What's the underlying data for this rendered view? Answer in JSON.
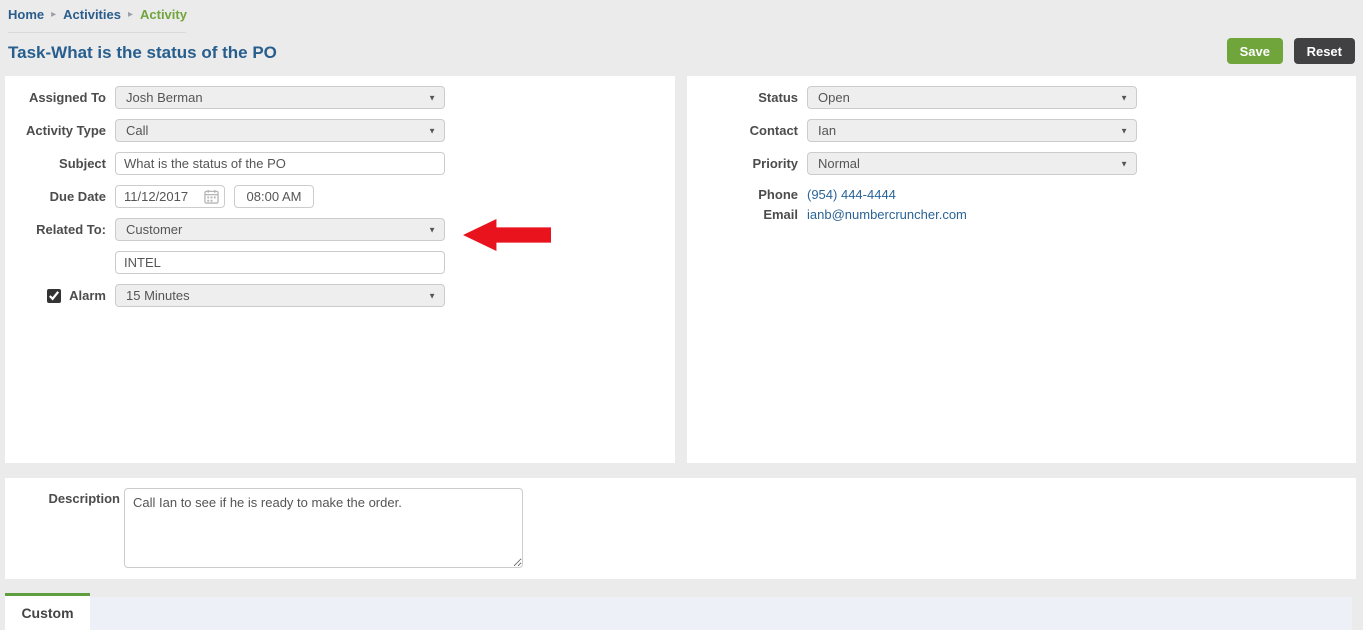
{
  "breadcrumb": {
    "separator": "▸",
    "home": "Home",
    "activities": "Activities",
    "current": "Activity"
  },
  "page": {
    "title": "Task-What is the status of the PO"
  },
  "toolbar": {
    "save_label": "Save",
    "reset_label": "Reset"
  },
  "left_panel": {
    "assigned_to": {
      "label": "Assigned To",
      "value": "Josh Berman"
    },
    "activity_type": {
      "label": "Activity Type",
      "value": "Call"
    },
    "subject": {
      "label": "Subject",
      "value": "What is the status of the PO"
    },
    "due_date": {
      "label": "Due Date",
      "date": "11/12/2017",
      "time": "08:00 AM"
    },
    "related_to": {
      "label": "Related To:",
      "value": "Customer"
    },
    "related_name": {
      "value": "INTEL"
    },
    "alarm": {
      "label": "Alarm",
      "checked": true,
      "value": "15 Minutes"
    }
  },
  "right_panel": {
    "status": {
      "label": "Status",
      "value": "Open"
    },
    "contact": {
      "label": "Contact",
      "value": "Ian"
    },
    "priority": {
      "label": "Priority",
      "value": "Normal"
    },
    "phone": {
      "label": "Phone",
      "value": "(954) 444-4444"
    },
    "email": {
      "label": "Email",
      "value": "ianb@numbercruncher.com"
    }
  },
  "description": {
    "label": "Description",
    "value": "Call Ian to see if he is ready to make the order."
  },
  "tabs": {
    "custom_label": "Custom"
  },
  "icons": {
    "dropdown_caret": "▼",
    "calendar": "calendar-icon"
  },
  "colors": {
    "page_background": "#ebebeb",
    "panel_background": "#ffffff",
    "title_blue": "#275e8e",
    "breadcrumb_blue": "#2a5d8c",
    "breadcrumb_green": "#71a53c",
    "save_green": "#6fa53a",
    "reset_dark": "#414042",
    "link_blue": "#2a6496",
    "arrow_red": "#e8131c",
    "tab_accent_green": "#5f9e3e",
    "tabbar_background": "#edf1f7",
    "dropdown_background": "#eeeeee"
  }
}
